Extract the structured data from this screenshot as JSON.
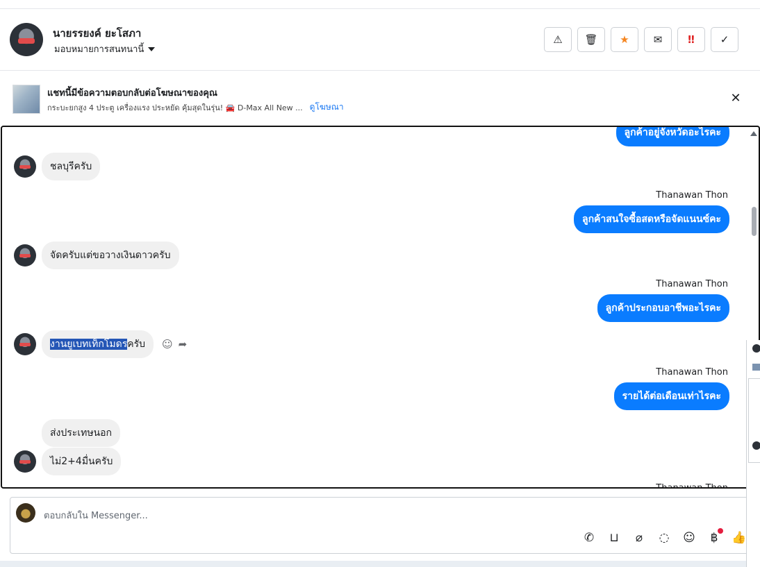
{
  "header": {
    "contact_name": "นายรรยงค์ ยะโสภา",
    "assign_label": "มอบหมายการสนทนานี้",
    "actions": [
      {
        "name": "report-spam-button",
        "icon": "⚠"
      },
      {
        "name": "delete-button",
        "icon": "🗑"
      },
      {
        "name": "star-button",
        "icon": "★"
      },
      {
        "name": "mark-unread-button",
        "icon": "✉"
      },
      {
        "name": "urgent-button",
        "icon": "‼"
      },
      {
        "name": "mark-done-button",
        "icon": "✓"
      }
    ]
  },
  "ad_banner": {
    "title": "แชทนี้มีข้อความตอบกลับต่อโฆษณาของคุณ",
    "subtitle": "กระบะยกสูง 4 ประตู เครื่องแรง ประหยัด คุ้มสุดในรุ่น! 🚘 D-Max All New ...",
    "link": "ดูโฆษณา",
    "close_icon": "✕"
  },
  "conversation": {
    "partial_top_out": "ลูกค้าอยู่จังหวัดอะไรคะ",
    "messages": [
      {
        "text": "ชลบุรีครับ"
      },
      {
        "sender": "Thanawan Thon",
        "text": "ลูกค้าสนใจซื้อสดหรือจัดแนนซ์คะ"
      },
      {
        "text": "จัดครับแต่ขอวางเงินดาวครับ"
      },
      {
        "sender": "Thanawan Thon",
        "text": "ลูกค้าประกอบอาชีพอะไรคะ"
      },
      {
        "text_highlighted": "งานยูเบทเท็กโมดร",
        "text_rest": "ครับ"
      },
      {
        "sender": "Thanawan Thon",
        "text": "รายได้ต่อเดือนเท่าไรคะ"
      },
      {
        "text": "ส่งประเทษนอก"
      },
      {
        "text": "ไม่2+4มื่นครับ"
      }
    ],
    "partial_bottom_sender": "Thanawan Thon"
  },
  "reply_box": {
    "placeholder": "ตอบกลับใน Messenger...",
    "tools": [
      "phone-plus-icon",
      "shopping-bag-icon",
      "paperclip-icon",
      "chat-bubble-icon",
      "emoji-icon",
      "baht-icon",
      "thumbs-up-icon"
    ]
  }
}
